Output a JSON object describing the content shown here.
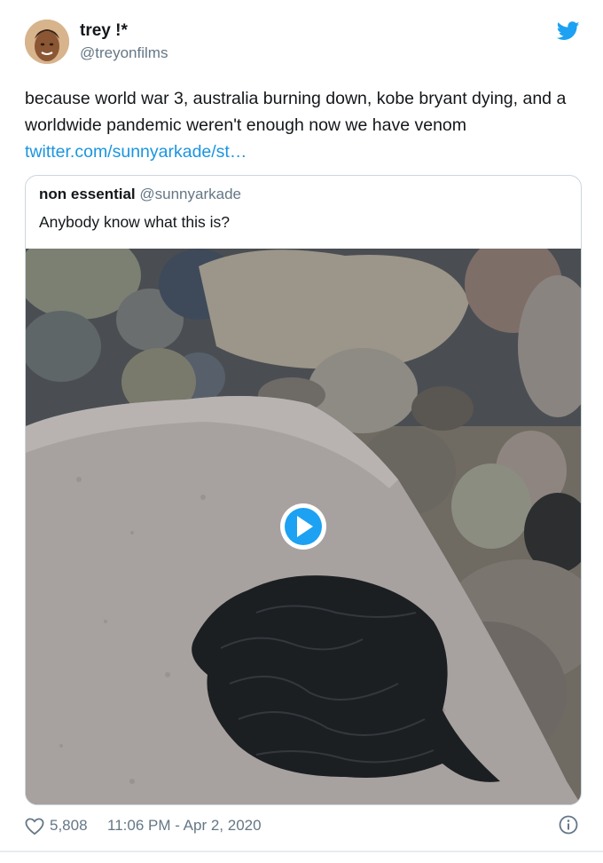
{
  "author": {
    "name": "trey !*",
    "handle": "@treyonfilms"
  },
  "tweet": {
    "text": "because world war 3, australia burning down, kobe bryant dying, and a worldwide pandemic weren't enough now we have venom",
    "link": "twitter.com/sunnyarkade/st…"
  },
  "quoted": {
    "name": "non essential",
    "handle": "@sunnyarkade",
    "text": "Anybody know what this is?"
  },
  "footer": {
    "likes": "5,808",
    "timestamp": "11:06 PM - Apr 2, 2020"
  },
  "colors": {
    "brand": "#1da1f2",
    "link": "#1b95e0",
    "muted": "#657786",
    "border": "#ccd6dd"
  },
  "icons": [
    "twitter-bird-icon",
    "heart-icon",
    "info-icon",
    "play-icon"
  ]
}
